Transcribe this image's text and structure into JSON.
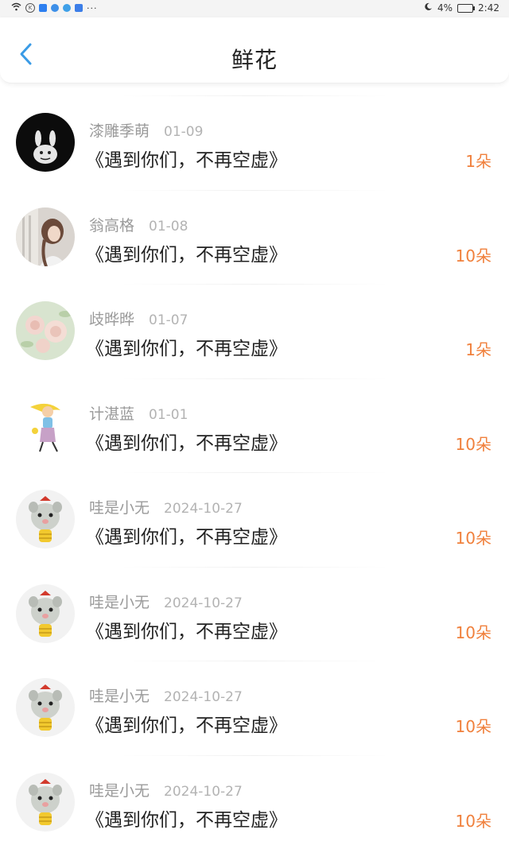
{
  "status_bar": {
    "battery_percent": "4%",
    "time": "2:42",
    "more": "···"
  },
  "header": {
    "title": "鲜花",
    "back_icon": "chevron-left-icon",
    "accent_color": "#3a9be6"
  },
  "colors": {
    "count": "#f0803c",
    "name": "#9a9a9a",
    "message": "#222222"
  },
  "items": [
    {
      "name": "漆雕季萌",
      "date": "01-09",
      "message": "《遇到你们，不再空虚》",
      "count": "1朵",
      "avatar": "black-bunny-avatar"
    },
    {
      "name": "翁高格",
      "date": "01-08",
      "message": "《遇到你们，不再空虚》",
      "count": "10朵",
      "avatar": "girl-photo-avatar"
    },
    {
      "name": "歧晔晔",
      "date": "01-07",
      "message": "《遇到你们，不再空虚》",
      "count": "1朵",
      "avatar": "roses-avatar"
    },
    {
      "name": "计湛蓝",
      "date": "01-01",
      "message": "《遇到你们，不再空虚》",
      "count": "10朵",
      "avatar": "cartoon-girl-avatar"
    },
    {
      "name": "哇是小无",
      "date": "2024-10-27",
      "message": "《遇到你们，不再空虚》",
      "count": "10朵",
      "avatar": "hamster-avatar"
    },
    {
      "name": "哇是小无",
      "date": "2024-10-27",
      "message": "《遇到你们，不再空虚》",
      "count": "10朵",
      "avatar": "hamster-avatar"
    },
    {
      "name": "哇是小无",
      "date": "2024-10-27",
      "message": "《遇到你们，不再空虚》",
      "count": "10朵",
      "avatar": "hamster-avatar"
    },
    {
      "name": "哇是小无",
      "date": "2024-10-27",
      "message": "《遇到你们，不再空虚》",
      "count": "10朵",
      "avatar": "hamster-avatar"
    }
  ]
}
